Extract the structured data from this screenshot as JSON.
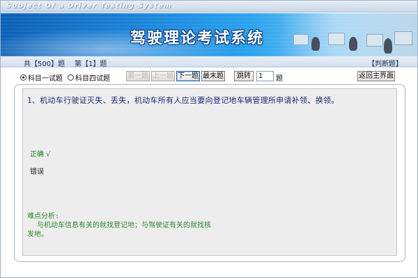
{
  "window": {
    "title": "Subject Of a Driver Testing System"
  },
  "banner": {
    "app_name": "驾驶理论考试系统"
  },
  "status": {
    "total_label": "共【500】题",
    "current_label": "第【1】题",
    "question_type": "【判断题】"
  },
  "controls": {
    "subject_one_label": "科目一试题",
    "subject_four_label": "科目四试题",
    "selected_subject": "科目一试题",
    "first_label": "第一题",
    "prev_label": "上一题",
    "next_label": "下一题",
    "last_label": "最末题",
    "jump_label": "跳转",
    "jump_value": "1",
    "jump_suffix": "题",
    "home_label": "返回主界面"
  },
  "question": {
    "text": "1、机动车行驶证灭失、丢失，机动车所有人应当要向登记地车辆管理所申请补领、换领。",
    "option_correct": "正确 √",
    "option_wrong": "错误",
    "analysis_title": "难点分析:",
    "analysis_line1": "与机动车信息有关的就找登记地；与驾驶证有关的就找核",
    "analysis_line2": "发地。"
  },
  "colors": {
    "banner_primary": "#1b86dc",
    "question_text": "#1b2b72",
    "correct_green": "#1e7d1e",
    "analysis_green": "#2b8a2b"
  }
}
